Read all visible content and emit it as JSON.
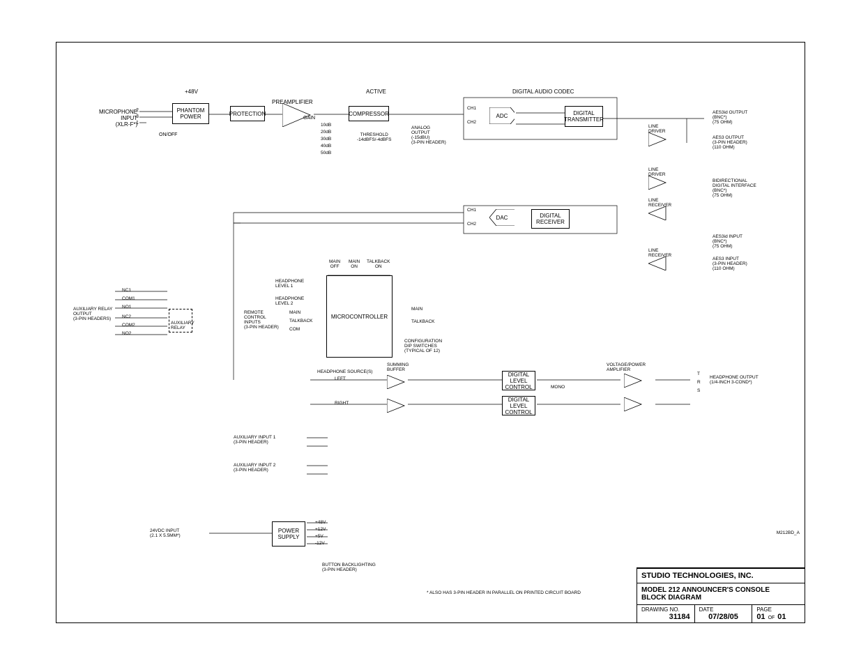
{
  "doc_id": "M212BD_A",
  "company": "STUDIO TECHNOLOGIES, INC.",
  "title": "MODEL 212 ANNOUNCER'S CONSOLE",
  "subtitle": "BLOCK DIAGRAM",
  "drawing_no_label": "DRAWING NO.",
  "drawing_no": "31184",
  "date_label": "DATE",
  "date": "07/28/05",
  "page_label": "PAGE",
  "page": "01",
  "page_of_label": "OF",
  "page_of": "01",
  "footnote": "* ALSO HAS 3-PIN HEADER IN PARALLEL ON PRINTED CIRCUIT BOARD",
  "blocks": {
    "phantom": "PHANTOM\nPOWER",
    "protection": "PROTECTION",
    "compressor": "COMPRESSOR",
    "adc": "ADC",
    "dac": "DAC",
    "tx": "DIGITAL\nTRANSMITTER",
    "rx": "DIGITAL\nRECEIVER",
    "micro": "MICROCONTROLLER",
    "dlc1": "DIGITAL\nLEVEL\nCONTROL",
    "dlc2": "DIGITAL\nLEVEL\nCONTROL",
    "psu": "POWER\nSUPPLY"
  },
  "labels": {
    "v48": "+48V",
    "active": "ACTIVE",
    "onoff": "ON/OFF",
    "preamp": "PREAMPLIFIER",
    "gain": "GAIN",
    "g10": "10dB",
    "g20": "20dB",
    "g30": "30dB",
    "g40": "40dB",
    "g50": "50dB",
    "thresh": "THRESHOLD\n-14dBFS/-4dBFS",
    "analog_out": "ANALOG\nOUTPUT\n(-15dBU)\n(3-PIN HEADER)",
    "codec": "DIGITAL AUDIO CODEC",
    "ch1": "CH1",
    "ch2": "CH2",
    "mic_in": "MICROPHONE\nINPUT\n(XLR-F*)",
    "pin1": "1",
    "pin2": "2",
    "pin3": "3",
    "line_driver": "LINE\nDRIVER",
    "line_receiver": "LINE\nRECEIVER",
    "aes3id_out": "AES3id OUTPUT\n(BNC*)\n(75 OHM)",
    "aes3_out": "AES3 OUTPUT\n(3-PIN HEADER)\n(110 OHM)",
    "bidi": "BIDIRECTIONAL\nDIGITAL INTERFACE\n(BNC*)\n(75 OHM)",
    "aes3id_in": "AES3id INPUT\n(BNC*)\n(75 OHM)",
    "aes3_in": "AES3 INPUT\n(3-PIN HEADER)\n(110 OHM)",
    "main_off": "MAIN\nOFF",
    "main_on": "MAIN\nON",
    "talkback_on": "TALKBACK\nON",
    "hp_lvl1": "HEADPHONE\nLEVEL 1",
    "hp_lvl2": "HEADPHONE\nLEVEL 2",
    "aux_relay": "AUXILIARY RELAY\nOUTPUT\n(3-PIN HEADERS)",
    "aux_relay_box": "AUXILIARY\nRELAY",
    "nc1": "NC1",
    "com1": "COM1",
    "no1": "NO1",
    "nc2": "NC2",
    "com2": "COM2",
    "no2": "NO2",
    "remote_in": "REMOTE\nCONTROL\nINPUTS\n(3-PIN HEADER)",
    "main_btn": "MAIN",
    "talkback_btn": "TALKBACK",
    "com": "COM",
    "main_led": "MAIN",
    "talkback_led": "TALKBACK",
    "config_sw": "CONFIGURATION\nDIP SWITCHES\n(TYPICAL OF 12)",
    "hp_sources": "HEADPHONE SOURCE(S)",
    "summing": "SUMMING\nBUFFER",
    "left": "LEFT",
    "right": "RIGHT",
    "mono": "MONO",
    "vpa": "VOLTAGE/POWER\nAMPLIFIER",
    "hp_out": "HEADPHONE OUTPUT\n(1/4-INCH 3-COND*)",
    "aux_in1": "AUXILIARY INPUT 1\n(3-PIN HEADER)",
    "aux_in2": "AUXILIARY INPUT 2\n(3-PIN HEADER)",
    "dc_in": "24VDC INPUT\n(2.1 X 5.5MM*)",
    "psu_48": "+48V",
    "psu_p12": "+12V",
    "psu_5": "+5V",
    "psu_n12": "-12V",
    "backlight": "BUTTON BACKLIGHTING\n(3-PIN HEADER)",
    "t": "T",
    "r": "R",
    "s": "S"
  }
}
